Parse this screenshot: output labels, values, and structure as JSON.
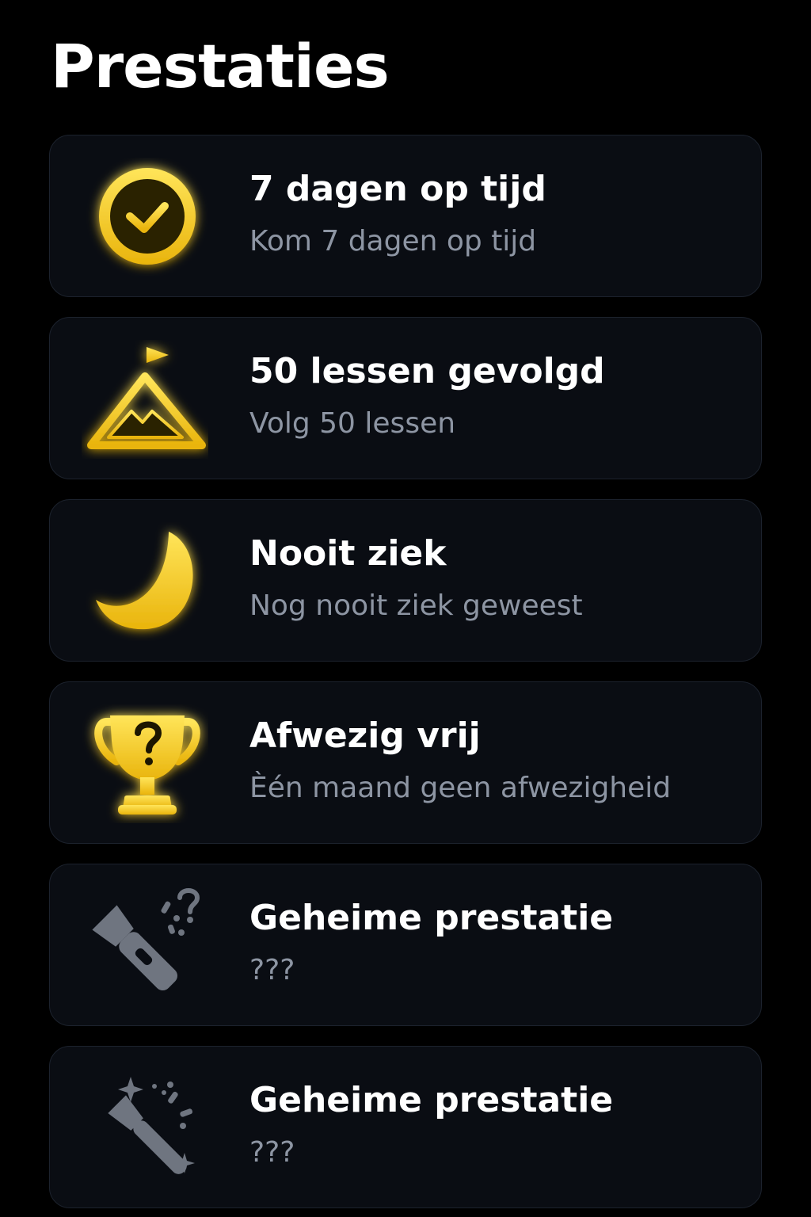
{
  "page": {
    "title": "Prestaties"
  },
  "colors": {
    "background": "#000000",
    "card": "#0a0d13",
    "card_border": "#1c222d",
    "title_text": "#ffffff",
    "subtitle_text": "#8d95a3",
    "gold": "#f6cf1e",
    "locked_gray": "#6f7580"
  },
  "achievements": [
    {
      "icon": "check-circle-icon",
      "title": "7 dagen op tijd",
      "subtitle": "Kom 7 dagen op tijd",
      "unlocked": true
    },
    {
      "icon": "mountain-flag-icon",
      "title": "50 lessen gevolgd",
      "subtitle": "Volg 50 lessen",
      "unlocked": true
    },
    {
      "icon": "moon-icon",
      "title": "Nooit ziek",
      "subtitle": "Nog nooit ziek geweest",
      "unlocked": true
    },
    {
      "icon": "trophy-question-icon",
      "title": "Afwezig vrij",
      "subtitle": "Èén maand geen afwezigheid",
      "unlocked": true
    },
    {
      "icon": "flashlight-question-icon",
      "title": "Geheime prestatie",
      "subtitle": "???",
      "unlocked": false
    },
    {
      "icon": "magic-wand-icon",
      "title": "Geheime prestatie",
      "subtitle": "???",
      "unlocked": false
    }
  ]
}
